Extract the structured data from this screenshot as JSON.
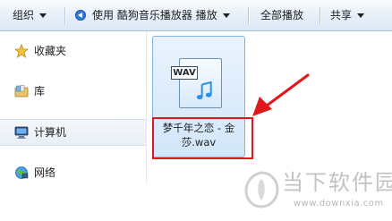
{
  "toolbar": {
    "organize_label": "组织",
    "play_with_label": "使用 酷狗音乐播放器 播放",
    "play_all_label": "全部播放",
    "share_label": "共享"
  },
  "nav": {
    "items": [
      {
        "label": "收藏夹",
        "icon": "star-icon"
      },
      {
        "label": "库",
        "icon": "library-icon"
      },
      {
        "label": "计算机",
        "icon": "computer-icon"
      },
      {
        "label": "网络",
        "icon": "network-icon"
      }
    ]
  },
  "file": {
    "type_badge": "WAV",
    "name_line1": "梦千年之恋 - 金",
    "name_line2": "莎.wav",
    "icon": "wav-file-icon"
  },
  "annotation": {
    "highlight_color": "#e0181e"
  },
  "watermark": {
    "title": "当下软件园",
    "url": "www.downxia.com"
  },
  "colors": {
    "accent": "#2f7ad8",
    "tile_bg": "#d2e6fa",
    "tile_border": "#85b4e4"
  }
}
